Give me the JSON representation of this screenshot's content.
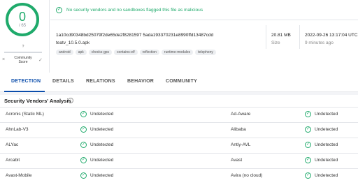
{
  "score": {
    "detected": "0",
    "total": "/ 65",
    "community_value": "?",
    "community_label": "Community Score",
    "negative_mark": "×",
    "positive_mark": "✓"
  },
  "banner": {
    "text": "No security vendors and no sandboxes flagged this file as malicious"
  },
  "file": {
    "hash": "1a10cd90348bd25079f2de65de2f8281597 5ada193370231e8990ffd13487cdd",
    "name": "teatv_10.5.0.apk",
    "tags": [
      "android",
      "apk",
      "checks-gps",
      "contains-elf",
      "reflection",
      "runtime-modules",
      "telephony"
    ],
    "size_value": "20.81 MB",
    "size_label": "Size",
    "date_value": "2022-09-26 13:17:04 UTC",
    "date_ago": "9 minutes ago"
  },
  "tabs": [
    "DETECTION",
    "DETAILS",
    "RELATIONS",
    "BEHAVIOR",
    "COMMUNITY"
  ],
  "section": {
    "title": "Security Vendors' Analysis",
    "info_icon": "i"
  },
  "rows": [
    {
      "left_vendor": "Acronis (Static ML)",
      "left_status": "Undetected",
      "right_vendor": "Ad-Aware",
      "right_status": "Undetected"
    },
    {
      "left_vendor": "AhnLab-V3",
      "left_status": "Undetected",
      "right_vendor": "Alibaba",
      "right_status": "Undetected"
    },
    {
      "left_vendor": "ALYac",
      "left_status": "Undetected",
      "right_vendor": "Antiy-AVL",
      "right_status": "Undetected"
    },
    {
      "left_vendor": "Arcabit",
      "left_status": "Undetected",
      "right_vendor": "Avast",
      "right_status": "Undetected"
    },
    {
      "left_vendor": "Avast-Mobile",
      "left_status": "Undetected",
      "right_vendor": "Avira (no cloud)",
      "right_status": "Undetected"
    }
  ],
  "icons": {
    "check": "✓"
  },
  "colors": {
    "green": "#1faa6b",
    "blue": "#0b4dab"
  }
}
